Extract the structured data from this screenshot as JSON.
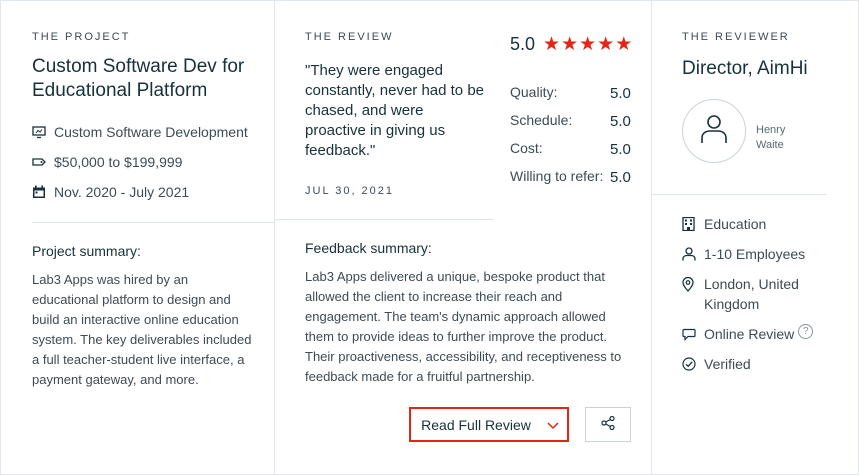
{
  "project": {
    "section_label": "THE PROJECT",
    "title": "Custom Software Dev for Educational Platform",
    "service": "Custom Software Development",
    "budget": "$50,000 to $199,999",
    "dates": "Nov. 2020 - July 2021",
    "summary_title": "Project summary:",
    "summary_text": "Lab3 Apps was hired by an educational platform to design and build an interactive online education system. The key deliverables included a full teacher-student live interface, a payment gateway, and more."
  },
  "review": {
    "section_label": "THE REVIEW",
    "quote": "\"They were engaged constantly, never had to be chased, and were proactive in giving us feedback.\"",
    "date": "JUL 30, 2021",
    "overall_score": "5.0",
    "stars": 5,
    "star_color": "#e62415",
    "scores": [
      {
        "label": "Quality:",
        "value": "5.0"
      },
      {
        "label": "Schedule:",
        "value": "5.0"
      },
      {
        "label": "Cost:",
        "value": "5.0"
      },
      {
        "label": "Willing to refer:",
        "value": "5.0"
      }
    ],
    "feedback_title": "Feedback summary:",
    "feedback_text": "Lab3 Apps delivered a unique, bespoke product that allowed the client to increase their reach and engagement. The team's dynamic approach allowed them to provide ideas to further improve the product. Their proactiveness, accessibility, and receptiveness to feedback made for a fruitful partnership.",
    "read_full_label": "Read Full Review",
    "accent_color": "#e62415"
  },
  "reviewer": {
    "section_label": "THE REVIEWER",
    "title": "Director, AimHi",
    "name": "Henry Waite",
    "industry": "Education",
    "company_size": "1-10 Employees",
    "location": "London, United Kingdom",
    "review_type": "Online Review",
    "review_type_help": "?",
    "status": "Verified"
  }
}
